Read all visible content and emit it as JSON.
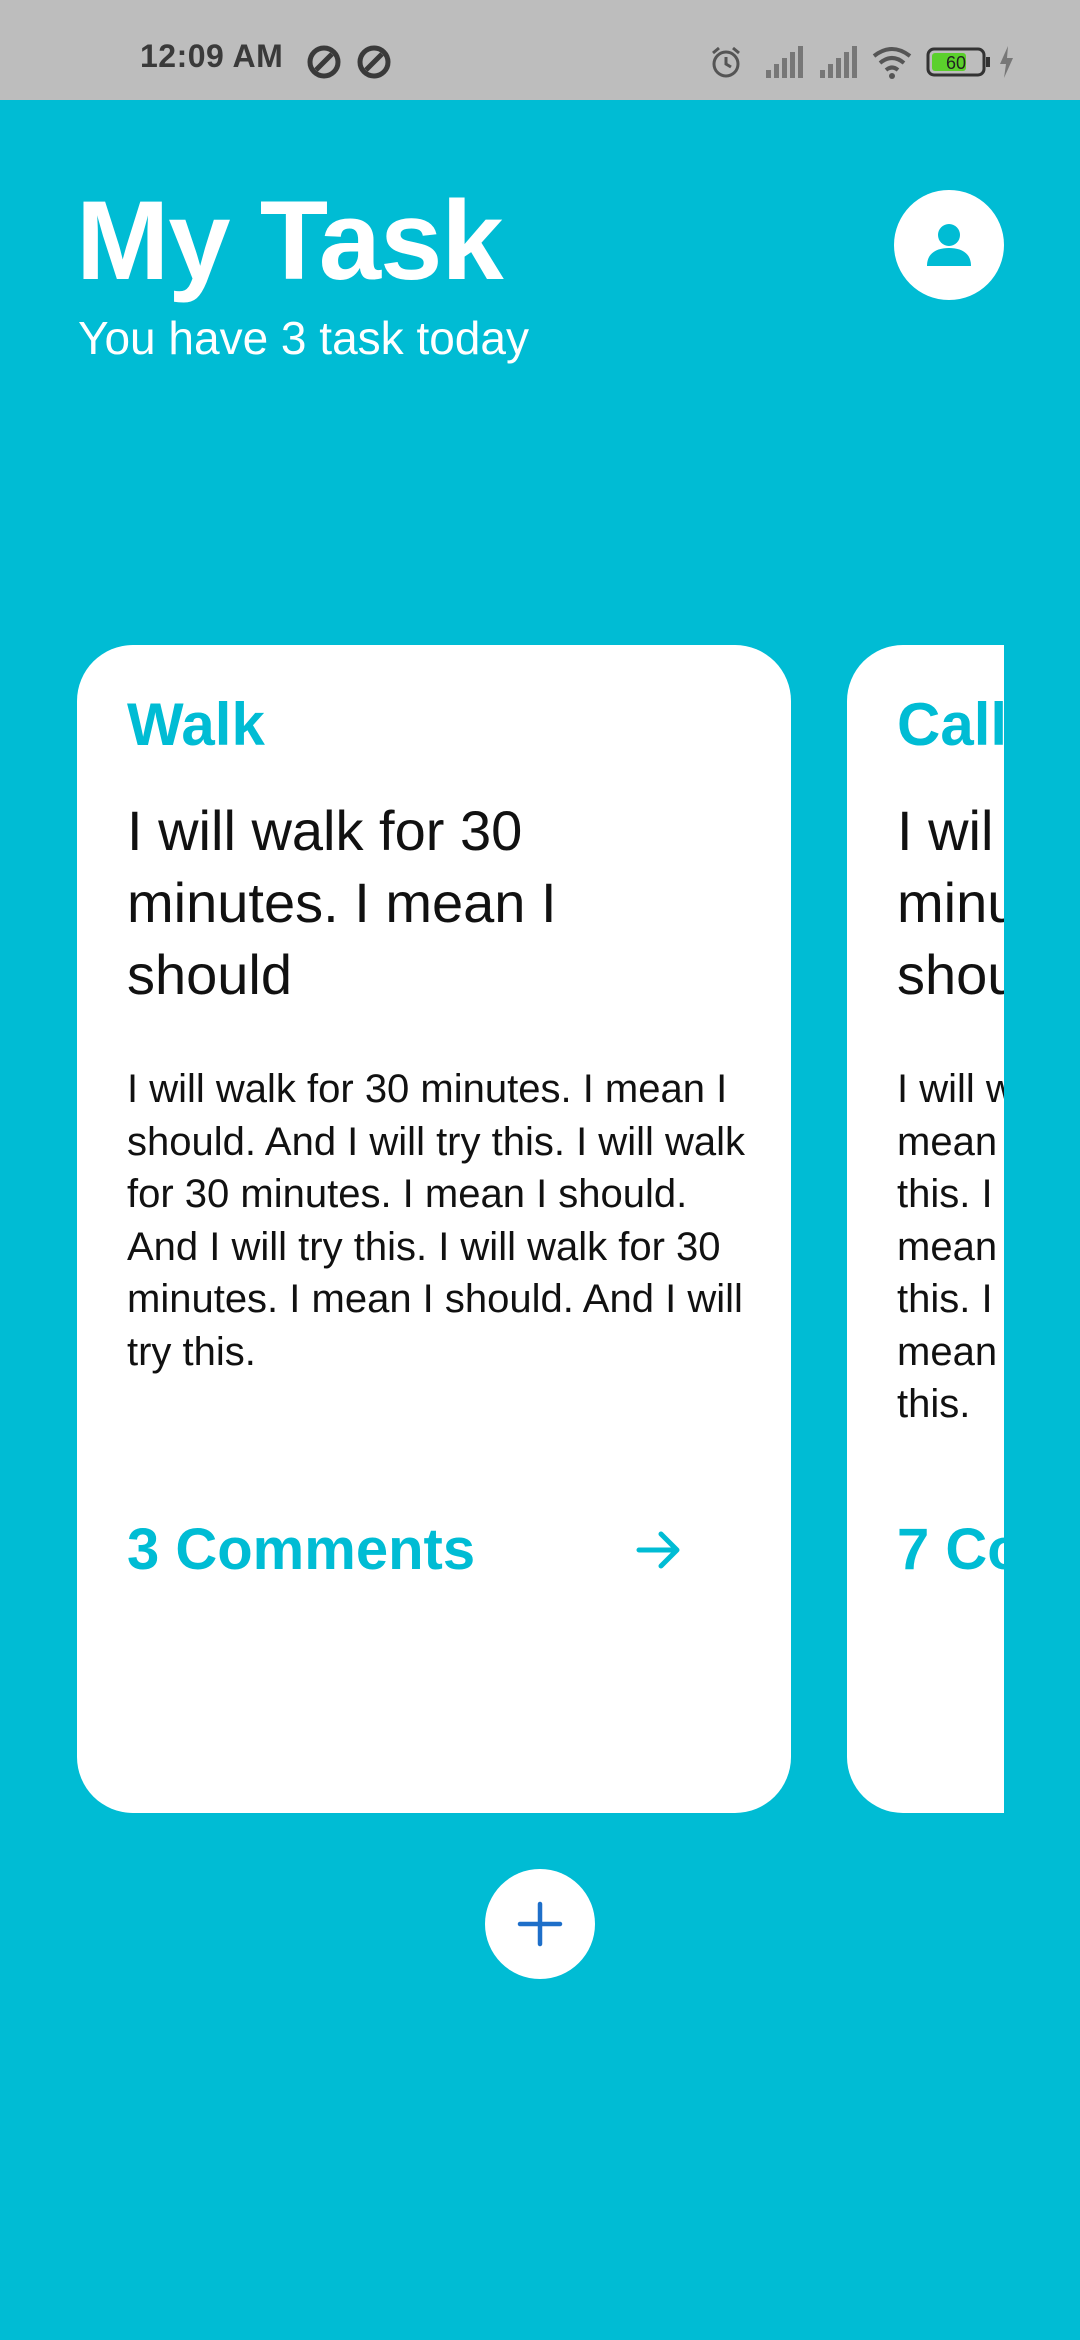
{
  "status_bar": {
    "time": "12:09 AM",
    "battery_level": "60",
    "icons": [
      "sync-icon",
      "sync-icon",
      "alarm-icon",
      "signal-icon",
      "signal-icon",
      "wifi-icon",
      "battery-icon",
      "charging-icon"
    ]
  },
  "header": {
    "title": "My Task",
    "subtitle": "You have 3 task today",
    "profile_icon": "person-icon"
  },
  "tasks": [
    {
      "title": "Walk",
      "heading": "I will walk for 30 minutes. I mean I should",
      "body": "I will walk for 30 minutes. I mean I should. And I will try this. I will walk for 30 minutes. I mean I should. And I will try this. I will walk for 30 minutes. I mean I should. And I will try this.",
      "comments": "3 Comments"
    },
    {
      "title": "Call",
      "heading_lines": [
        "I wil",
        "minu",
        "shou"
      ],
      "body_lines": [
        "I will w",
        "mean",
        "this. I",
        "mean",
        "this. I",
        "mean",
        "this."
      ],
      "comments": "7 Co"
    }
  ],
  "actions": {
    "add_icon": "plus-icon"
  },
  "colors": {
    "accent": "#00BCD4",
    "card": "#FFFFFF",
    "text": "#111111",
    "add_icon": "#1E6FC9",
    "status_bar": "#BDBDBD"
  }
}
